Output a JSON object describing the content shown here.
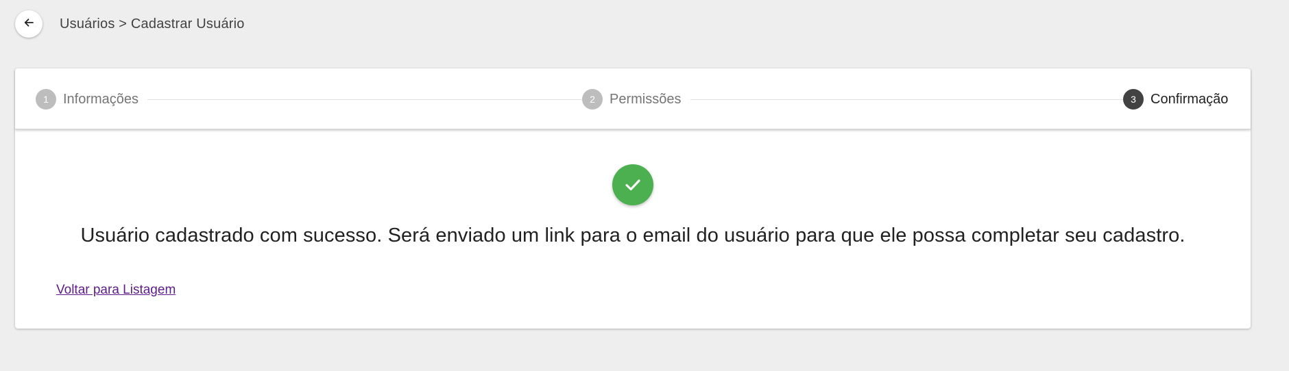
{
  "header": {
    "breadcrumb": "Usuários > Cadastrar Usuário"
  },
  "stepper": {
    "steps": [
      {
        "number": "1",
        "label": "Informações"
      },
      {
        "number": "2",
        "label": "Permissões"
      },
      {
        "number": "3",
        "label": "Confirmação"
      }
    ],
    "active_step": 3
  },
  "content": {
    "message": "Usuário cadastrado com sucesso. Será enviado um link para o email do usuário para que ele possa completar seu cadastro.",
    "back_link": "Voltar para Listagem"
  },
  "colors": {
    "success": "#4caf50",
    "step_inactive": "#bdbdbd",
    "step_active": "#424242",
    "link": "#5e1a8c"
  }
}
